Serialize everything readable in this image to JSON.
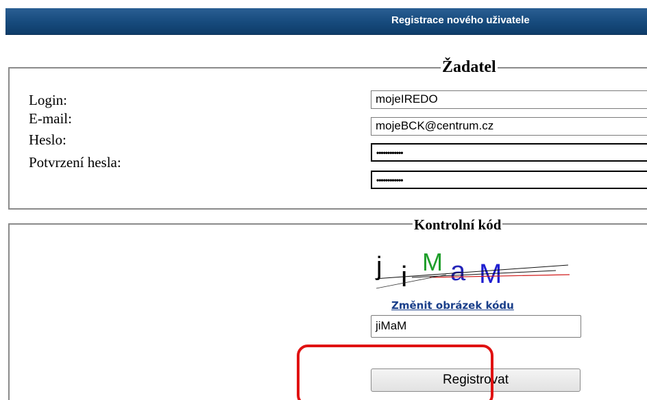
{
  "header": {
    "title": "Registrace nového uživatele"
  },
  "applicant": {
    "legend": "Žadatel",
    "fields": [
      {
        "label": "Login:",
        "value": "mojeIREDO",
        "type": "text"
      },
      {
        "label": "E-mail:",
        "value": "mojeBCK@centrum.cz",
        "type": "text"
      },
      {
        "label": "Heslo:",
        "value": "••••••••••••",
        "type": "password"
      },
      {
        "label": "Potvrzení hesla:",
        "value": "••••••••••••",
        "type": "password"
      }
    ]
  },
  "captcha": {
    "legend": "Kontrolní kód",
    "image_text": "jiMaM",
    "change_link": "Změnit obrázek kódu",
    "input_value": "jiMaM"
  },
  "actions": {
    "register_label": "Registrovat"
  },
  "colors": {
    "header_bg": "#164a7c",
    "link": "#1a3f8a",
    "highlight": "#e01212"
  }
}
